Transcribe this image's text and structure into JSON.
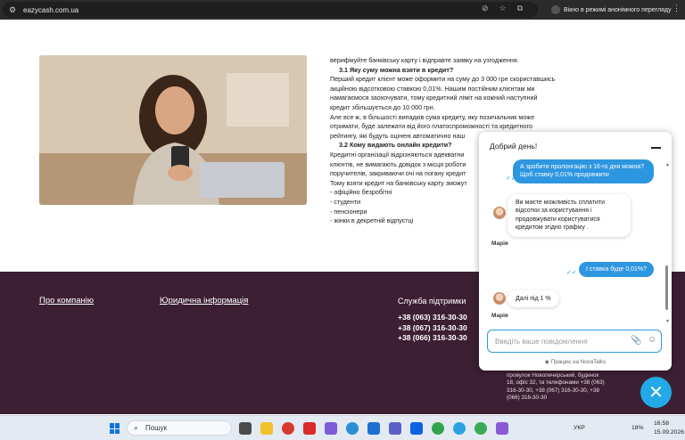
{
  "browser": {
    "url": "eazycash.com.ua",
    "incognito_label": "Вікно в режимі анонімного перегляду",
    "icons": [
      "eye-off-icon",
      "star-icon",
      "extensions-icon",
      "incognito-icon",
      "menu-dots-icon"
    ]
  },
  "article": {
    "lines": [
      {
        "text": "верифікуйте банківську карту і відправте заявку на узгодження.",
        "heading": false
      },
      {
        "text": "3.1 Яку суму можна взяти в кредит?",
        "heading": true
      },
      {
        "text": "Перший кредит клієнт може оформити на суму до 3 000 грн скориставшись",
        "heading": false
      },
      {
        "text": "акційною відсотковою ставкою 0,01%. Нашим постійним клієнтам ми",
        "heading": false
      },
      {
        "text": "намагаємося заохочувати, тому кредитний ліміт на кожний наступний",
        "heading": false
      },
      {
        "text": "кредит збільшується до 10 000 грн.",
        "heading": false
      },
      {
        "text": "Але все ж, в більшості випадків сума кредиту, яку позичальник може",
        "heading": false
      },
      {
        "text": "отримати, буде залежати від його платоспроможності та кредитного",
        "heading": false
      },
      {
        "text": "рейтингу, які будуть оцінені автоматично наш",
        "heading": false
      },
      {
        "text": "3.2 Кому видають онлайн кредити?",
        "heading": true
      },
      {
        "text": "Кредитні організації відрізняються адекватни",
        "heading": false
      },
      {
        "text": "клієнтів, не вимагають довідок з місця роботи",
        "heading": false
      },
      {
        "text": "поручителів, закриваючи очі на погану кредит",
        "heading": false
      },
      {
        "text": "Тому взяти кредит на банківську карту зможут",
        "heading": false
      },
      {
        "text": "- офіційно безробітні",
        "heading": false
      },
      {
        "text": "- студенти",
        "heading": false
      },
      {
        "text": "- пенсіонери",
        "heading": false
      },
      {
        "text": "- жінки в декретній відпустці",
        "heading": false
      }
    ]
  },
  "footer": {
    "about": "Про компанію",
    "legal": "Юридична інформація",
    "support_title": "Служба підтримки",
    "phones": [
      "+38 (063) 316-30-30",
      "+38 (067) 316-30-30",
      "+38 (066) 316-30-30"
    ],
    "address": "провулок Новопечерський, будинок 18, офіс 32, та телефонами +38 (063) 316-30-30, +38 (067) 316-30-30, +38 (066) 316-30-30"
  },
  "chat": {
    "title": "Добрий день!",
    "messages": [
      {
        "from": "user",
        "text": "А зробити пролонгацію з 16-го дня можна? Щоб ставку 0,01% продовжити"
      },
      {
        "from": "agent",
        "text": "Ви маєте можливість сплатити відсотки за користування і продовжувати користуватися кредитом згідно графіку ."
      },
      {
        "from": "user",
        "text": "І ставка буде 0,01%?"
      },
      {
        "from": "agent",
        "text": "Далі під 1 %"
      }
    ],
    "agent_name": "Марія",
    "input_placeholder": "Введіть ваше повідомлення",
    "powered_by": "Працює на NovaTalks"
  },
  "taskbar": {
    "search_label": "Пошук",
    "language": "УКР",
    "battery": "18%",
    "time": "16:58",
    "date": "15.09.2026"
  }
}
